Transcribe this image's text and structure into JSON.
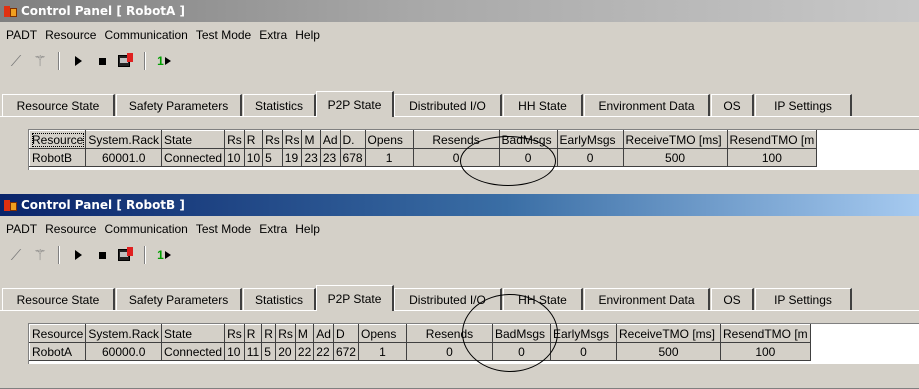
{
  "panels": [
    {
      "title": "Control Panel [ RobotA ]",
      "menu": [
        "PADT",
        "Resource",
        "Communication",
        "Test Mode",
        "Extra",
        "Help"
      ],
      "toolbar_text": "1",
      "tabs": [
        "Resource State",
        "Safety Parameters",
        "Statistics",
        "P2P State",
        "Distributed I/O",
        "HH State",
        "Environment Data",
        "OS",
        "IP Settings"
      ],
      "active_tab": "P2P State",
      "columns": [
        "Resource",
        "System.Rack",
        "State",
        "Rs",
        "R",
        "Rs",
        "Rs",
        "M",
        "Ad",
        "D.",
        "Opens",
        "Resends",
        "BadMsgs",
        "EarlyMsgs",
        "ReceiveTMO [ms]",
        "ResendTMO [m"
      ],
      "row": [
        "RobotB",
        "60001.0",
        "Connected",
        "10",
        "10",
        "5",
        "19",
        "23",
        "23",
        "678",
        "1",
        "0",
        "0",
        "0",
        "500",
        "100"
      ]
    },
    {
      "title": "Control Panel [ RobotB ]",
      "menu": [
        "PADT",
        "Resource",
        "Communication",
        "Test Mode",
        "Extra",
        "Help"
      ],
      "toolbar_text": "1",
      "tabs": [
        "Resource State",
        "Safety Parameters",
        "Statistics",
        "P2P State",
        "Distributed I/O",
        "HH State",
        "Environment Data",
        "OS",
        "IP Settings"
      ],
      "active_tab": "P2P State",
      "columns": [
        "Resource",
        "System.Rack",
        "State",
        "Rs",
        "R",
        "R",
        "Rs",
        "M",
        "Ad",
        "D",
        "Opens",
        "Resends",
        "BadMsgs",
        "EarlyMsgs",
        "ReceiveTMO [ms]",
        "ResendTMO [m"
      ],
      "row": [
        "RobotA",
        "60000.0",
        "Connected",
        "10",
        "11",
        "5",
        "20",
        "22",
        "22",
        "672",
        "1",
        "0",
        "0",
        "0",
        "500",
        "100"
      ]
    }
  ],
  "colors": {
    "window_bg": "#d4d0c8",
    "active_title": "#0a246a",
    "inactive_title": "#808080"
  },
  "icons": [
    "app-icon",
    "connect-icon",
    "wand-icon",
    "play-icon",
    "stop-icon",
    "download-icon",
    "run-once-icon"
  ]
}
